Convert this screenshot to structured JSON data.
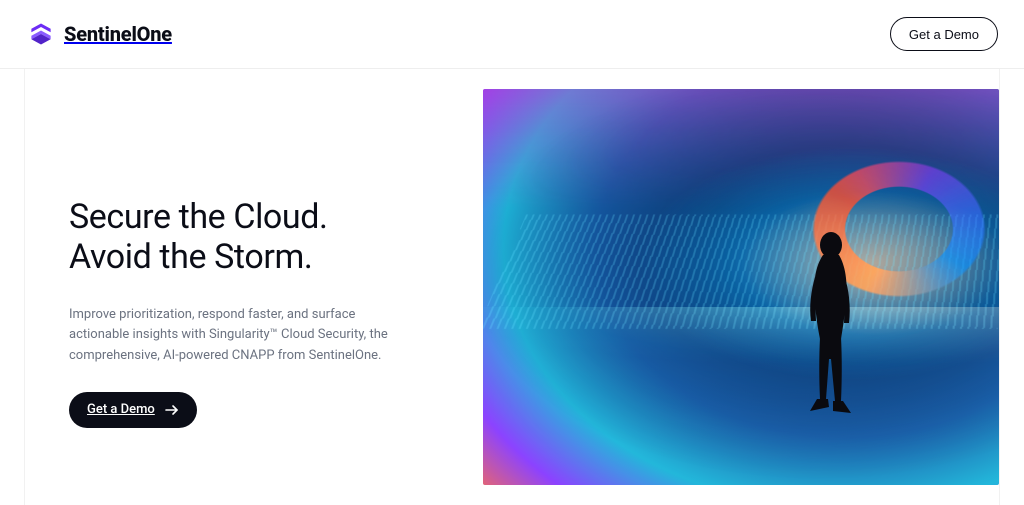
{
  "header": {
    "brand_name": "SentinelOne",
    "cta_label": "Get a Demo"
  },
  "hero": {
    "headline_line1": "Secure the Cloud.",
    "headline_line2": "Avoid the Storm.",
    "subhead": "Improve prioritization, respond faster, and surface actionable insights with Singularity™ Cloud Security, the comprehensive, AI-powered CNAPP from SentinelOne.",
    "cta_label": "Get a Demo",
    "image_alt": "Person standing in front of an immersive curved screen showing a swirling, colorful light vortex"
  },
  "colors": {
    "brand_purple": "#6d2cf5",
    "text_primary": "#0b0d17",
    "text_muted": "#6b7280",
    "button_bg": "#0b0d17",
    "button_fg": "#ffffff"
  }
}
